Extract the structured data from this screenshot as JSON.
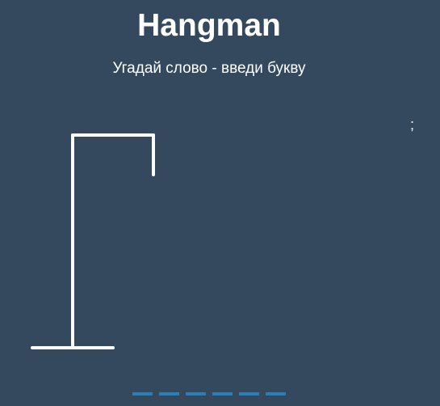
{
  "header": {
    "title": "Hangman",
    "subtitle": "Угадай слово - введи букву"
  },
  "wrong_letters": ";",
  "word": {
    "length": 6
  },
  "colors": {
    "background": "#34495e",
    "text": "#ffffff",
    "gallows": "#ffffff",
    "letter_slot": "#2980b9"
  }
}
